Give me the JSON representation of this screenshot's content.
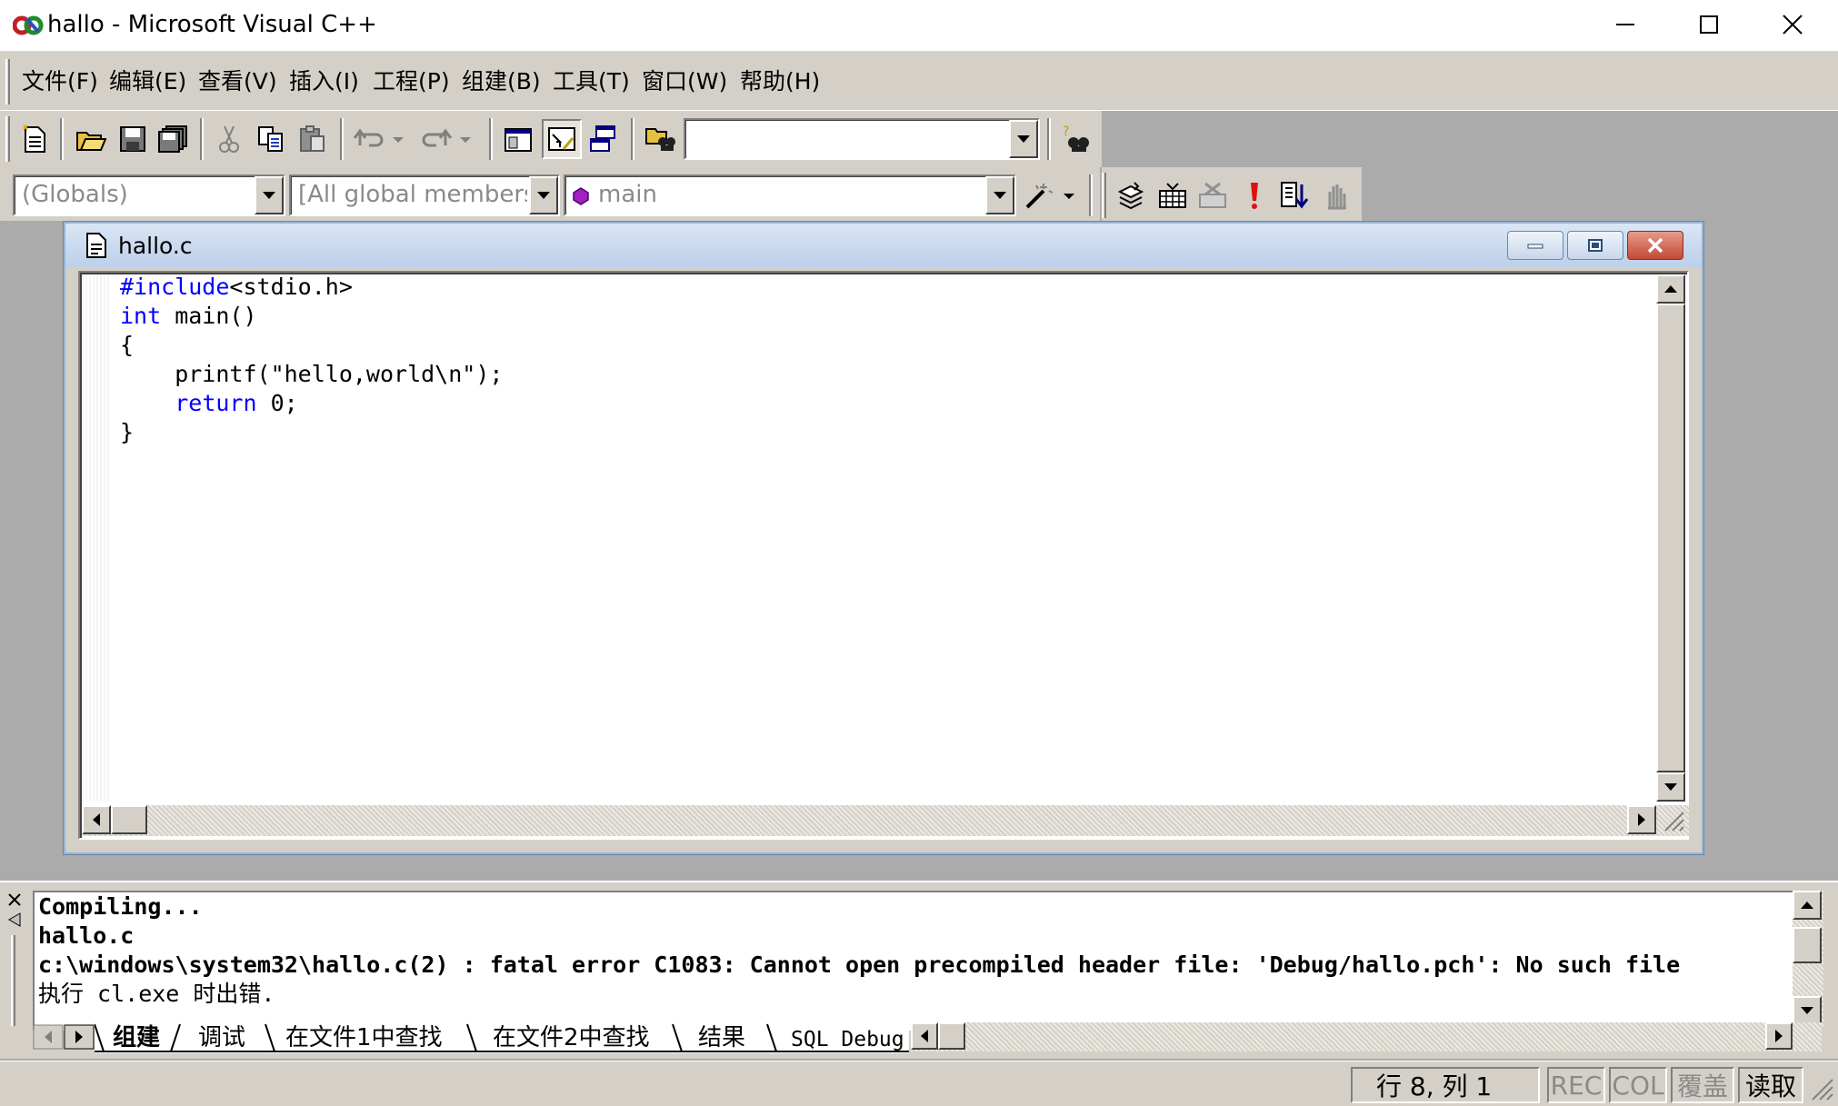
{
  "window": {
    "title": "hallo - Microsoft Visual C++",
    "minimize_glyph": "—",
    "maximize_glyph": "☐",
    "close_glyph": "✕"
  },
  "menu": [
    "文件(F)",
    "编辑(E)",
    "查看(V)",
    "插入(I)",
    "工程(P)",
    "组建(B)",
    "工具(T)",
    "窗口(W)",
    "帮助(H)"
  ],
  "toolbar": {
    "find_combo_value": "",
    "icons": [
      "new-text-file-icon",
      "open-folder-icon",
      "save-icon",
      "save-all-icon",
      "cut-icon",
      "copy-icon",
      "paste-icon",
      "undo-icon",
      "redo-icon",
      "workspace-icon",
      "output-icon",
      "window-list-icon",
      "find-in-files-icon",
      "search-icon"
    ]
  },
  "wizardbar": {
    "class_combo": "(Globals)",
    "filter_combo": "[All global members",
    "member_combo": "main",
    "icons": [
      "magic-wand-icon",
      "compile-icon",
      "build-icon",
      "stop-build-icon",
      "execute-icon",
      "go-icon",
      "breakpoint-icon"
    ]
  },
  "document": {
    "title": "hallo.c",
    "code_lines": [
      [
        {
          "t": "#include",
          "k": true
        },
        {
          "t": "<stdio.h>",
          "k": false
        }
      ],
      [
        {
          "t": "int",
          "k": true
        },
        {
          "t": " main()",
          "k": false
        }
      ],
      [
        {
          "t": "{",
          "k": false
        }
      ],
      [
        {
          "t": "    printf(\"hello,world\\n\");",
          "k": false
        }
      ],
      [
        {
          "t": "    ",
          "k": false
        },
        {
          "t": "return",
          "k": true
        },
        {
          "t": " 0;",
          "k": false
        }
      ],
      [
        {
          "t": "}",
          "k": false
        }
      ]
    ]
  },
  "output": {
    "lines": [
      "Compiling...",
      "hallo.c",
      "c:\\windows\\system32\\hallo.c(2) : fatal error C1083: Cannot open precompiled header file: 'Debug/hallo.pch': No such file",
      "执行 cl.exe 时出错."
    ],
    "tabs": [
      "组建",
      "调试",
      "在文件1中查找",
      "在文件2中查找",
      "结果",
      "SQL Debug"
    ]
  },
  "status": {
    "position": "行 8, 列 1",
    "rec": "REC",
    "col": "COL",
    "ovr": "覆盖",
    "read": "读取"
  },
  "colors": {
    "keyword": "#0000ff",
    "face": "#d4d0c8",
    "mdi_background": "#ababab"
  }
}
